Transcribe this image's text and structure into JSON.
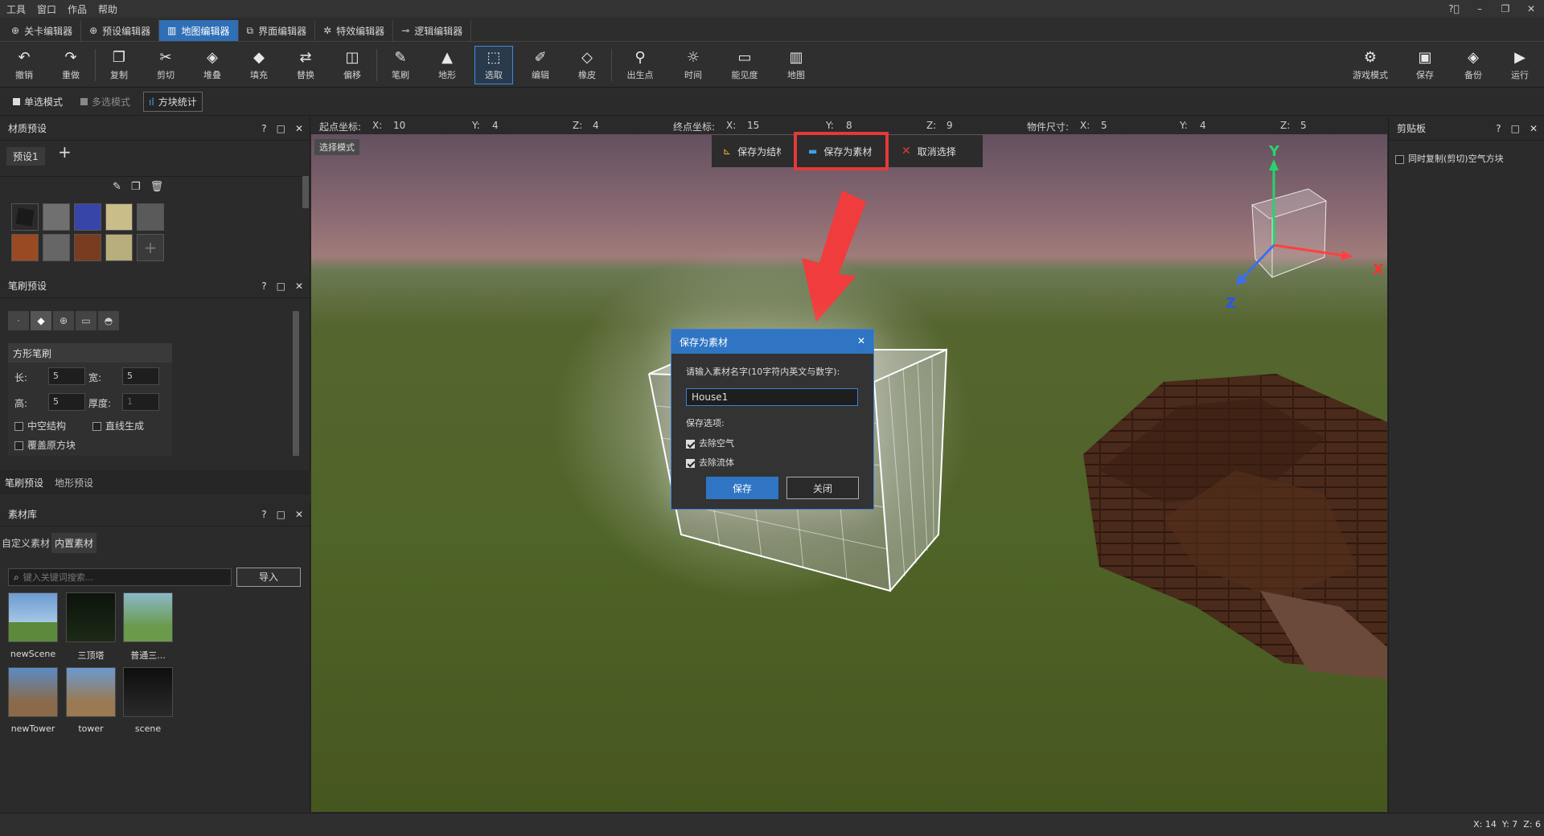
{
  "menubar": {
    "items": [
      "工具",
      "窗口",
      "作品",
      "帮助"
    ]
  },
  "window_controls": {
    "help": "?⃝",
    "minimize": "–",
    "restore": "❐",
    "close": "✕"
  },
  "editor_tabs": [
    {
      "label": "关卡编辑器",
      "icon": "level-icon"
    },
    {
      "label": "预设编辑器",
      "icon": "preset-icon"
    },
    {
      "label": "地图编辑器",
      "icon": "map-icon",
      "active": true
    },
    {
      "label": "界面编辑器",
      "icon": "ui-icon"
    },
    {
      "label": "特效编辑器",
      "icon": "effect-icon"
    },
    {
      "label": "逻辑编辑器",
      "icon": "logic-icon"
    }
  ],
  "toolbar": {
    "undo": "撤销",
    "redo": "重做",
    "copy": "复制",
    "cut": "剪切",
    "stack": "堆叠",
    "fill": "填充",
    "replace": "替换",
    "offset": "偏移",
    "brush": "笔刷",
    "terrain": "地形",
    "select": "选取",
    "edit": "编辑",
    "eraser": "橡皮",
    "spawn": "出生点",
    "time": "时间",
    "visibility": "能见度",
    "map": "地图",
    "game_mode": "游戏模式",
    "save": "保存",
    "backup": "备份",
    "run": "运行"
  },
  "modebar": {
    "single": "单选模式",
    "multi": "多选模式",
    "stats": "方块统计"
  },
  "material_panel": {
    "title": "材质预设",
    "preset_tab": "预设1",
    "add": "+"
  },
  "brush_panel": {
    "title": "笔刷预设",
    "section": "方形笔刷",
    "length_label": "长:",
    "length": "5",
    "width_label": "宽:",
    "width": "5",
    "height_label": "高:",
    "height": "5",
    "thickness_label": "厚度:",
    "thickness": "1",
    "hollow": "中空结构",
    "line": "直线生成",
    "overwrite": "覆盖原方块",
    "tab_brush": "笔刷预设",
    "tab_terrain": "地形预设"
  },
  "library_panel": {
    "title": "素材库",
    "tab_custom": "自定义素材",
    "tab_builtin": "内置素材",
    "search_placeholder": "键入关键词搜索...",
    "import": "导入",
    "assets": [
      "newScene",
      "三顶塔",
      "普通三...",
      "newTower",
      "tower",
      "scene"
    ]
  },
  "panel_controls": {
    "help": "?",
    "float": "□",
    "close": "✕"
  },
  "coords": {
    "start_label": "起点坐标:",
    "sx_label": "X:",
    "sx": "10",
    "sy_label": "Y:",
    "sy": "4",
    "sz_label": "Z:",
    "sz": "4",
    "end_label": "终点坐标:",
    "ex_label": "X:",
    "ex": "15",
    "ey_label": "Y:",
    "ey": "8",
    "ez_label": "Z:",
    "ez": "9",
    "size_label": "物件尺寸:",
    "wx_label": "X:",
    "wx": "5",
    "wy_label": "Y:",
    "wy": "4",
    "wz_label": "Z:",
    "wz": "5"
  },
  "viewport": {
    "mode_label": "选择模式",
    "axis_x": "X",
    "axis_y": "Y",
    "axis_z": "Z"
  },
  "floatbar": {
    "save_structure": "保存为结构",
    "save_material": "保存为素材",
    "cancel": "取消选择"
  },
  "dialog": {
    "title": "保存为素材",
    "prompt": "请输入素材名字(10字符内英文与数字):",
    "name_value": "House1",
    "options_label": "保存选项:",
    "opt_air": "去除空气",
    "opt_fluid": "去除流体",
    "save": "保存",
    "close": "关闭"
  },
  "clipboard_panel": {
    "title": "剪贴板",
    "copy_air": "同时复制(剪切)空气方块"
  },
  "status": {
    "coords": "X: 14  Y: 7  Z: 6"
  },
  "colors": {
    "accent": "#2f75c4",
    "highlight_red": "#e23a3a",
    "arrow_red": "#f03c3c"
  }
}
